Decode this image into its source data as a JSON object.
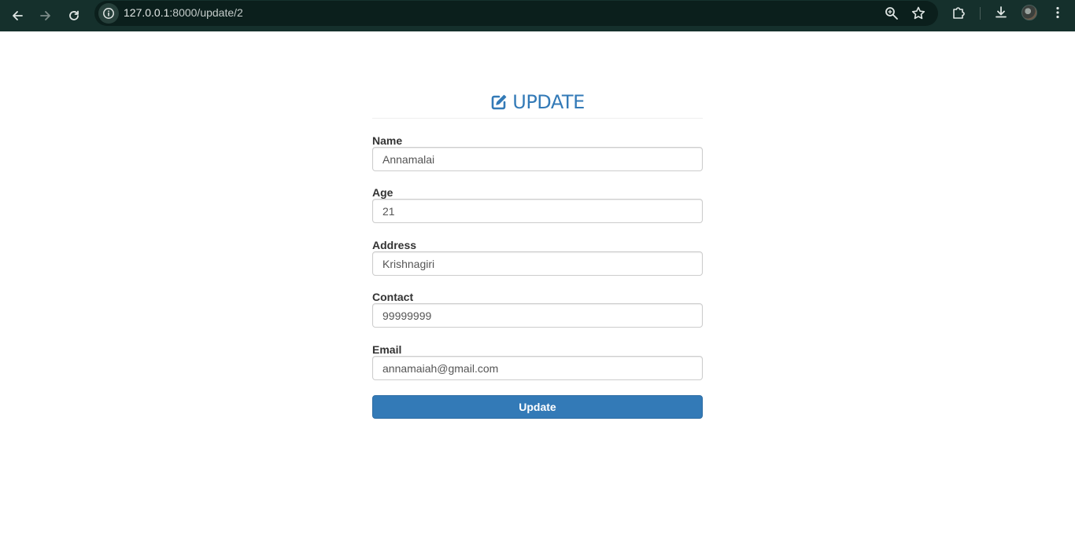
{
  "browser": {
    "url_host": "127.0.0.1",
    "url_rest": ":8000/update/2",
    "icons": [
      "back-icon",
      "forward-icon",
      "reload-icon",
      "site-info-icon",
      "zoom-icon",
      "bookmark-star-icon",
      "extensions-icon",
      "download-icon",
      "profile-avatar",
      "menu-icon"
    ]
  },
  "form": {
    "title": "UPDATE",
    "title_icon": "edit-icon",
    "accent_color": "#337ab7",
    "fields": [
      {
        "label": "Name",
        "value": "Annamalai"
      },
      {
        "label": "Age",
        "value": "21"
      },
      {
        "label": "Address",
        "value": "Krishnagiri"
      },
      {
        "label": "Contact",
        "value": "99999999"
      },
      {
        "label": "Email",
        "value": "annamaiah@gmail.com"
      }
    ],
    "submit_label": "Update"
  }
}
